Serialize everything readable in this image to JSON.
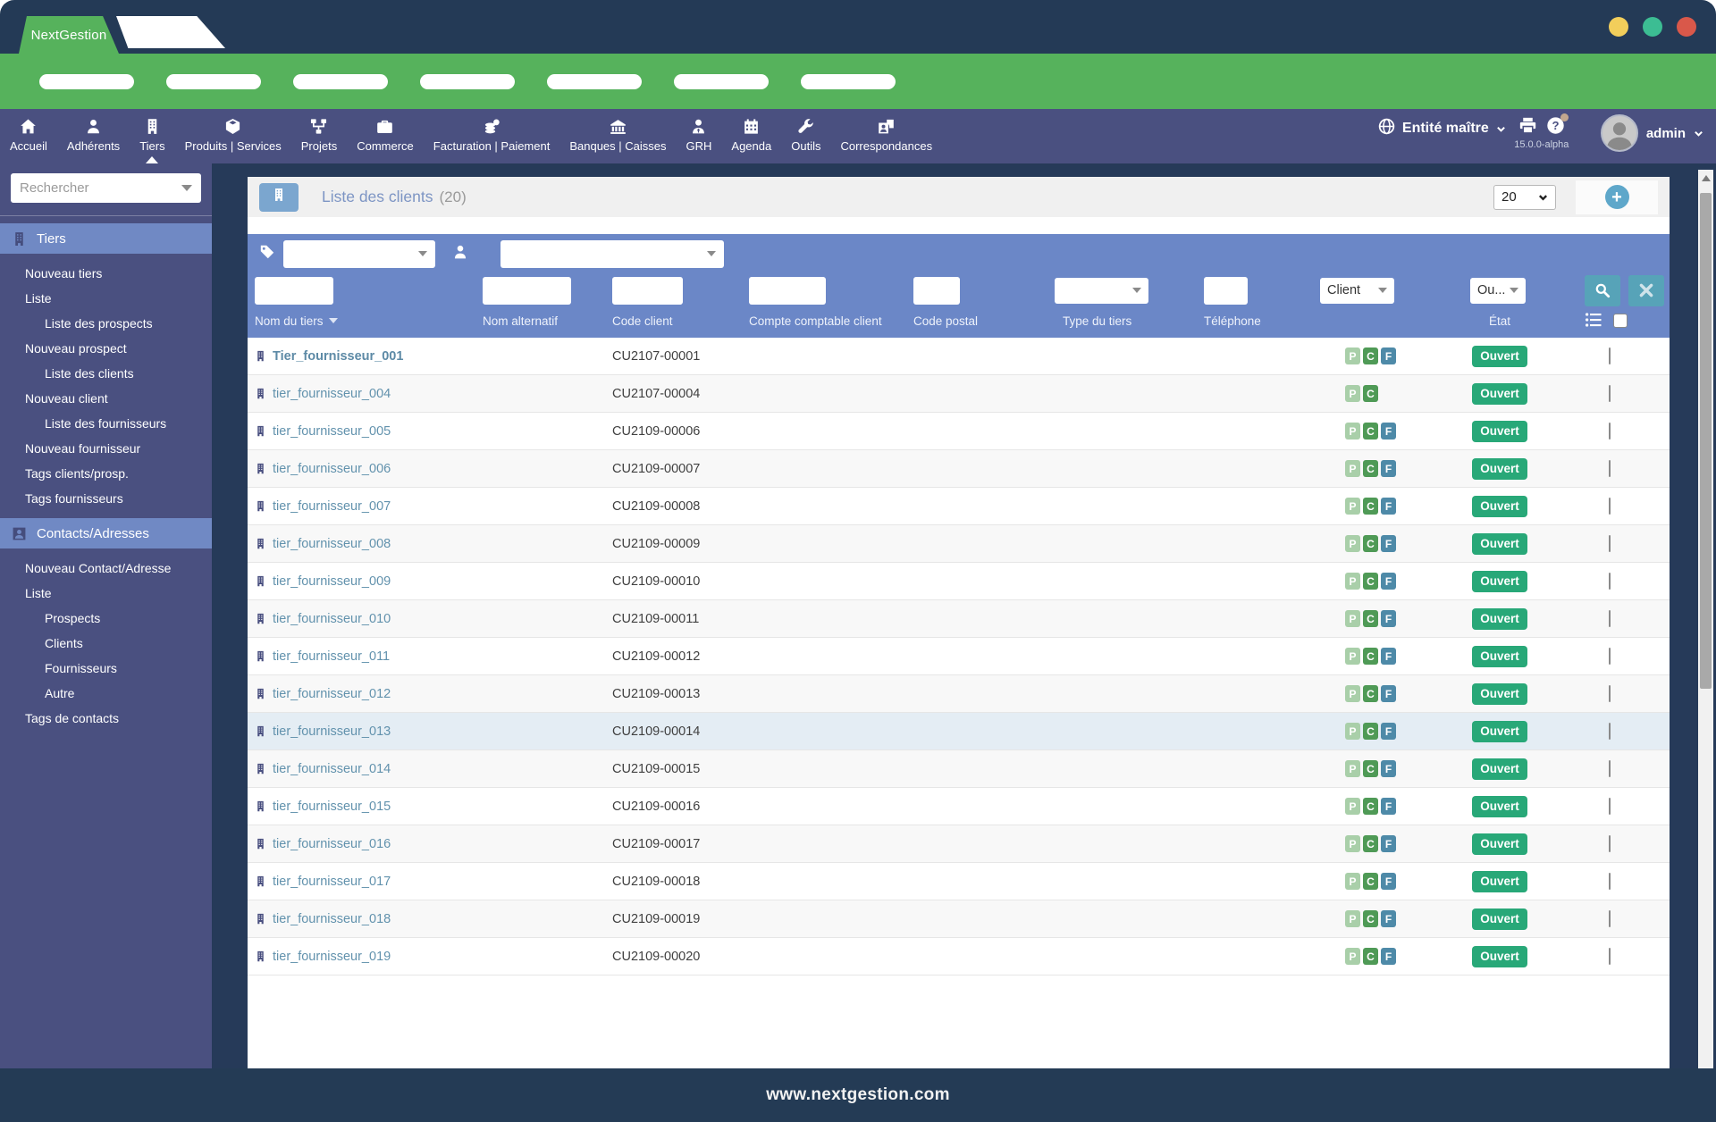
{
  "window": {
    "traffic_lights": [
      "#f2ce5b",
      "#3cbd93",
      "#d9584a"
    ]
  },
  "brand": {
    "name": "NextGestion"
  },
  "pillbar": {
    "pill_count": 7
  },
  "nav": {
    "items": [
      {
        "label": "Accueil",
        "icon": "home-icon",
        "active": false
      },
      {
        "label": "Adhérents",
        "icon": "member-icon",
        "active": false
      },
      {
        "label": "Tiers",
        "icon": "building-icon",
        "active": true
      },
      {
        "label": "Produits | Services",
        "icon": "cube-icon",
        "active": false
      },
      {
        "label": "Projets",
        "icon": "diagram-icon",
        "active": false
      },
      {
        "label": "Commerce",
        "icon": "briefcase-icon",
        "active": false
      },
      {
        "label": "Facturation | Paiement",
        "icon": "coins-icon",
        "active": false
      },
      {
        "label": "Banques | Caisses",
        "icon": "bank-icon",
        "active": false
      },
      {
        "label": "GRH",
        "icon": "user-tie-icon",
        "active": false
      },
      {
        "label": "Agenda",
        "icon": "calendar-icon",
        "active": false
      },
      {
        "label": "Outils",
        "icon": "wrench-icon",
        "active": false
      },
      {
        "label": "Correspondances",
        "icon": "address-book-icon",
        "active": false
      }
    ],
    "entity_label": "Entité maître",
    "version": "15.0.0-alpha",
    "user_name": "admin"
  },
  "sidebar": {
    "search_placeholder": "Rechercher",
    "sections": [
      {
        "title": "Tiers",
        "icon": "building-icon",
        "items": [
          {
            "label": "Nouveau tiers",
            "indent": false
          },
          {
            "label": "Liste",
            "indent": false
          },
          {
            "label": "Liste des prospects",
            "indent": true
          },
          {
            "label": "Nouveau prospect",
            "indent": false
          },
          {
            "label": "Liste des clients",
            "indent": true
          },
          {
            "label": "Nouveau client",
            "indent": false
          },
          {
            "label": "Liste des fournisseurs",
            "indent": true
          },
          {
            "label": "Nouveau fournisseur",
            "indent": false
          },
          {
            "label": "Tags clients/prosp.",
            "indent": false
          },
          {
            "label": "Tags fournisseurs",
            "indent": false
          }
        ]
      },
      {
        "title": "Contacts/Adresses",
        "icon": "contact-icon",
        "items": [
          {
            "label": "Nouveau Contact/Adresse",
            "indent": false
          },
          {
            "label": "Liste",
            "indent": false
          },
          {
            "label": "Prospects",
            "indent": true
          },
          {
            "label": "Clients",
            "indent": true
          },
          {
            "label": "Fournisseurs",
            "indent": true
          },
          {
            "label": "Autre",
            "indent": true
          },
          {
            "label": "Tags de contacts",
            "indent": false
          }
        ]
      }
    ]
  },
  "page": {
    "title": "Liste des clients",
    "count": "(20)",
    "page_size": "20",
    "add_button": "+"
  },
  "filters": {
    "client_type_select": "Client",
    "etat_select": "Ou...",
    "columns": {
      "nom_du_tiers": "Nom du tiers",
      "nom_alternatif": "Nom alternatif",
      "code_client": "Code client",
      "compte_comptable": "Compte comptable client",
      "code_postal": "Code postal",
      "type_du_tiers": "Type du tiers",
      "telephone": "Téléphone",
      "etat": "État"
    }
  },
  "table": {
    "badge_colors": {
      "P": "#a9cfa9",
      "C": "#4f9a56",
      "F": "#4e8aa8"
    },
    "state_color": "#28a878",
    "rows": [
      {
        "name": "Tier_fournisseur_001",
        "code": "CU2107-00001",
        "badges": [
          "P",
          "C",
          "F"
        ],
        "state": "Ouvert",
        "bold": true,
        "highlighted": false
      },
      {
        "name": "tier_fournisseur_004",
        "code": "CU2107-00004",
        "badges": [
          "P",
          "C"
        ],
        "state": "Ouvert",
        "bold": false,
        "highlighted": false
      },
      {
        "name": "tier_fournisseur_005",
        "code": "CU2109-00006",
        "badges": [
          "P",
          "C",
          "F"
        ],
        "state": "Ouvert",
        "bold": false,
        "highlighted": false
      },
      {
        "name": "tier_fournisseur_006",
        "code": "CU2109-00007",
        "badges": [
          "P",
          "C",
          "F"
        ],
        "state": "Ouvert",
        "bold": false,
        "highlighted": false
      },
      {
        "name": "tier_fournisseur_007",
        "code": "CU2109-00008",
        "badges": [
          "P",
          "C",
          "F"
        ],
        "state": "Ouvert",
        "bold": false,
        "highlighted": false
      },
      {
        "name": "tier_fournisseur_008",
        "code": "CU2109-00009",
        "badges": [
          "P",
          "C",
          "F"
        ],
        "state": "Ouvert",
        "bold": false,
        "highlighted": false
      },
      {
        "name": "tier_fournisseur_009",
        "code": "CU2109-00010",
        "badges": [
          "P",
          "C",
          "F"
        ],
        "state": "Ouvert",
        "bold": false,
        "highlighted": false
      },
      {
        "name": "tier_fournisseur_010",
        "code": "CU2109-00011",
        "badges": [
          "P",
          "C",
          "F"
        ],
        "state": "Ouvert",
        "bold": false,
        "highlighted": false
      },
      {
        "name": "tier_fournisseur_011",
        "code": "CU2109-00012",
        "badges": [
          "P",
          "C",
          "F"
        ],
        "state": "Ouvert",
        "bold": false,
        "highlighted": false
      },
      {
        "name": "tier_fournisseur_012",
        "code": "CU2109-00013",
        "badges": [
          "P",
          "C",
          "F"
        ],
        "state": "Ouvert",
        "bold": false,
        "highlighted": false
      },
      {
        "name": "tier_fournisseur_013",
        "code": "CU2109-00014",
        "badges": [
          "P",
          "C",
          "F"
        ],
        "state": "Ouvert",
        "bold": false,
        "highlighted": true
      },
      {
        "name": "tier_fournisseur_014",
        "code": "CU2109-00015",
        "badges": [
          "P",
          "C",
          "F"
        ],
        "state": "Ouvert",
        "bold": false,
        "highlighted": false
      },
      {
        "name": "tier_fournisseur_015",
        "code": "CU2109-00016",
        "badges": [
          "P",
          "C",
          "F"
        ],
        "state": "Ouvert",
        "bold": false,
        "highlighted": false
      },
      {
        "name": "tier_fournisseur_016",
        "code": "CU2109-00017",
        "badges": [
          "P",
          "C",
          "F"
        ],
        "state": "Ouvert",
        "bold": false,
        "highlighted": false
      },
      {
        "name": "tier_fournisseur_017",
        "code": "CU2109-00018",
        "badges": [
          "P",
          "C",
          "F"
        ],
        "state": "Ouvert",
        "bold": false,
        "highlighted": false
      },
      {
        "name": "tier_fournisseur_018",
        "code": "CU2109-00019",
        "badges": [
          "P",
          "C",
          "F"
        ],
        "state": "Ouvert",
        "bold": false,
        "highlighted": false
      },
      {
        "name": "tier_fournisseur_019",
        "code": "CU2109-00020",
        "badges": [
          "P",
          "C",
          "F"
        ],
        "state": "Ouvert",
        "bold": false,
        "highlighted": false
      }
    ]
  },
  "footer": {
    "url": "www.nextgestion.com"
  }
}
